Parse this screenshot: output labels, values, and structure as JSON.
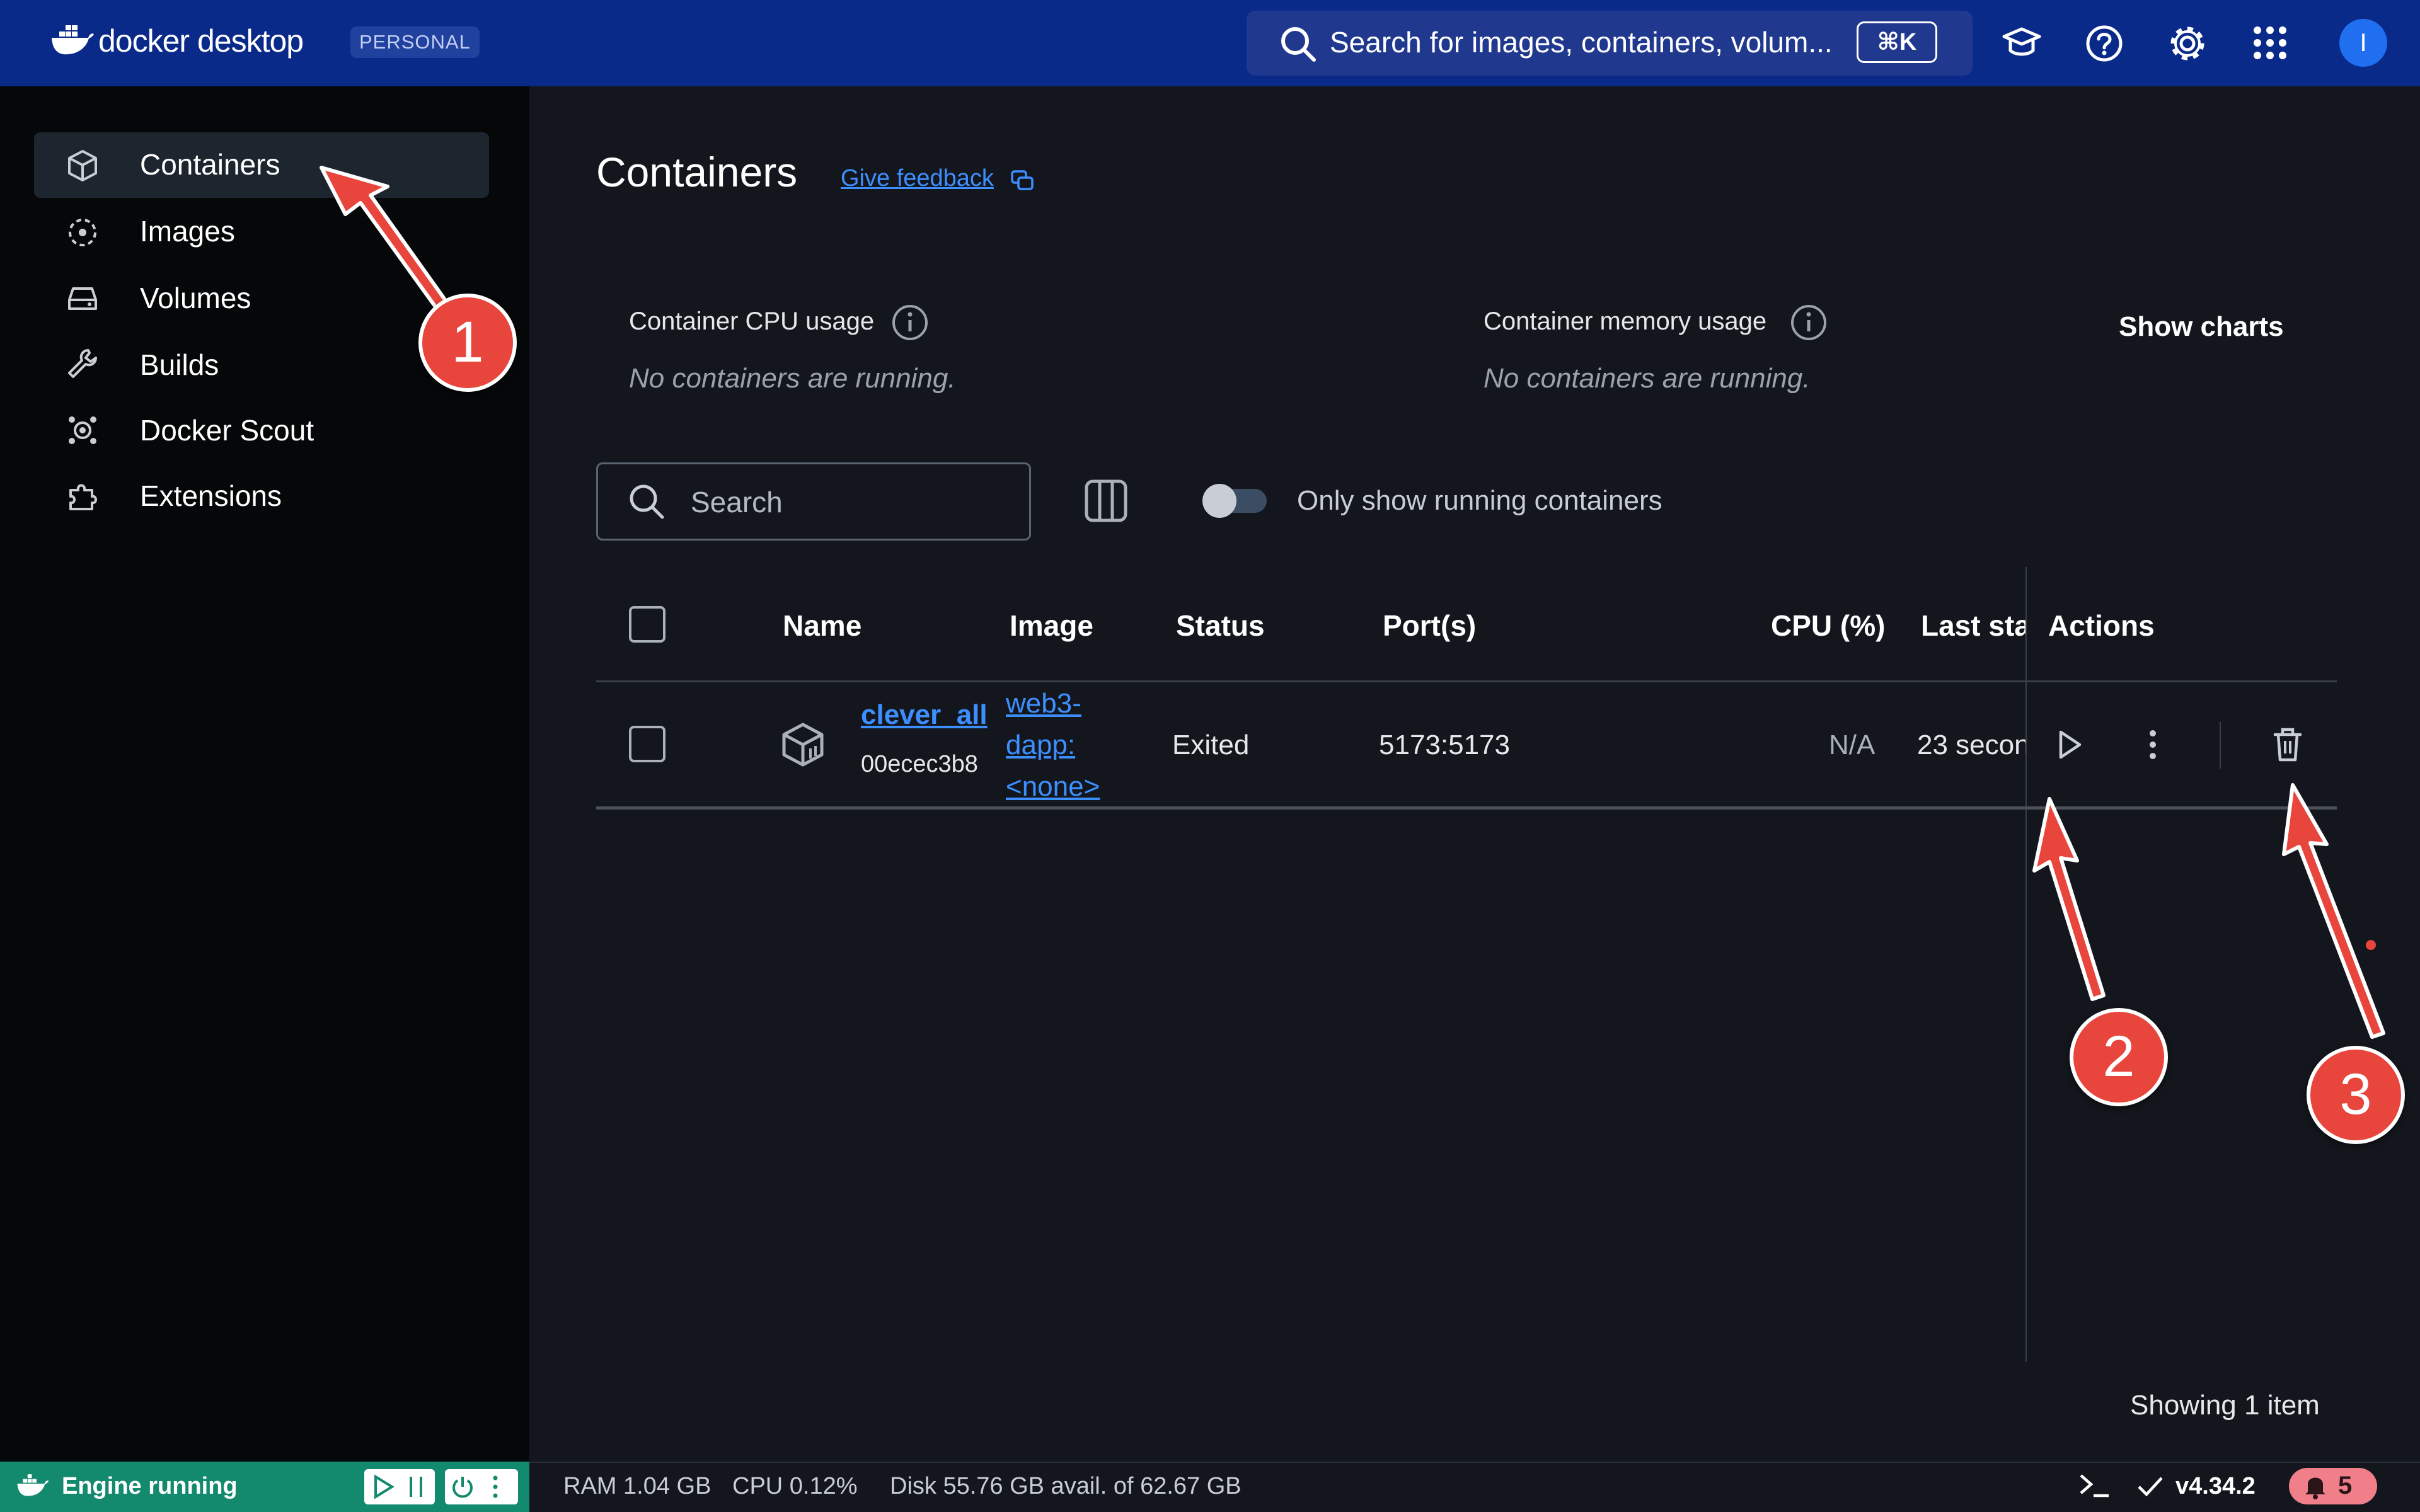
{
  "topbar": {
    "logo_text": "docker desktop",
    "plan_badge": "PERSONAL",
    "search_placeholder": "Search for images, containers, volum...",
    "search_shortcut": "⌘K",
    "avatar_initial": "I"
  },
  "sidebar": {
    "items": [
      {
        "label": "Containers",
        "icon": "cube-icon",
        "active": true
      },
      {
        "label": "Images",
        "icon": "images-icon"
      },
      {
        "label": "Volumes",
        "icon": "volume-icon"
      },
      {
        "label": "Builds",
        "icon": "wrench-icon"
      },
      {
        "label": "Docker Scout",
        "icon": "scout-icon"
      },
      {
        "label": "Extensions",
        "icon": "puzzle-icon"
      }
    ]
  },
  "main": {
    "title": "Containers",
    "feedback_label": "Give feedback",
    "cpu_usage_label": "Container CPU usage",
    "cpu_usage_value": "No containers are running.",
    "memory_usage_label": "Container memory usage",
    "memory_usage_value": "No containers are running.",
    "show_charts": "Show charts",
    "search_placeholder": "Search",
    "only_running_label": "Only show running containers",
    "only_running_checked": false,
    "showing_items": "Showing 1 item"
  },
  "table": {
    "columns": [
      "Name",
      "Image",
      "Status",
      "Port(s)",
      "CPU (%)",
      "Last sta",
      "Actions"
    ],
    "rows": [
      {
        "name": "clever_all",
        "id": "00ecec3b8",
        "image_line1": "web3-",
        "image_line2": "dapp:",
        "image_line3": "<none>",
        "status": "Exited",
        "ports": "5173:5173",
        "cpu": "N/A",
        "last_started": "23 secon"
      }
    ]
  },
  "footer": {
    "engine_status": "Engine running",
    "ram": "RAM 1.04 GB",
    "cpu": "CPU 0.12%",
    "disk": "Disk 55.76 GB avail. of 62.67 GB",
    "version": "v4.34.2",
    "notifications": "5"
  },
  "annotations": {
    "marker_1": "1",
    "marker_2": "2",
    "marker_3": "3",
    "color": "#e8453c"
  }
}
